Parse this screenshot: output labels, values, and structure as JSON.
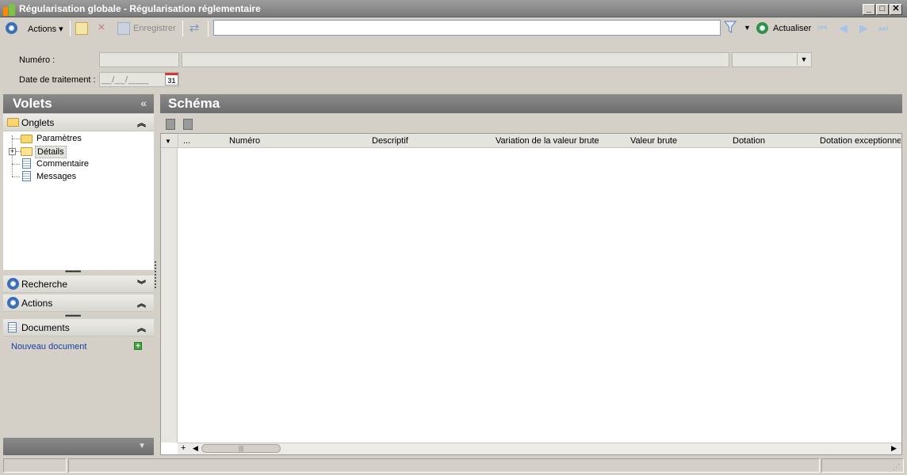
{
  "window": {
    "title": "Régularisation globale - Régularisation réglementaire",
    "minimize": "_",
    "maximize": "□",
    "close": "✕"
  },
  "toolbar": {
    "actions_label": "Actions",
    "save_label": "Enregistrer",
    "search_value": "",
    "refresh_label": "Actualiser"
  },
  "form": {
    "numero_label": "Numéro :",
    "date_label": "Date de traitement :",
    "date_placeholder": "__/__/____",
    "calendar_day": "31"
  },
  "left_pane": {
    "title": "Volets",
    "collapse_glyph": "«",
    "onglets": {
      "label": "Onglets",
      "items": [
        "Paramètres",
        "Détails",
        "Commentaire",
        "Messages"
      ]
    },
    "recherche_label": "Recherche",
    "actions_label": "Actions",
    "documents": {
      "label": "Documents",
      "new_document": "Nouveau document"
    }
  },
  "schema": {
    "title": "Schéma",
    "columns": [
      "...",
      "Numéro",
      "Descriptif",
      "Variation de la valeur brute",
      "Valeur brute",
      "Dotation",
      "Dotation exceptionne"
    ]
  }
}
